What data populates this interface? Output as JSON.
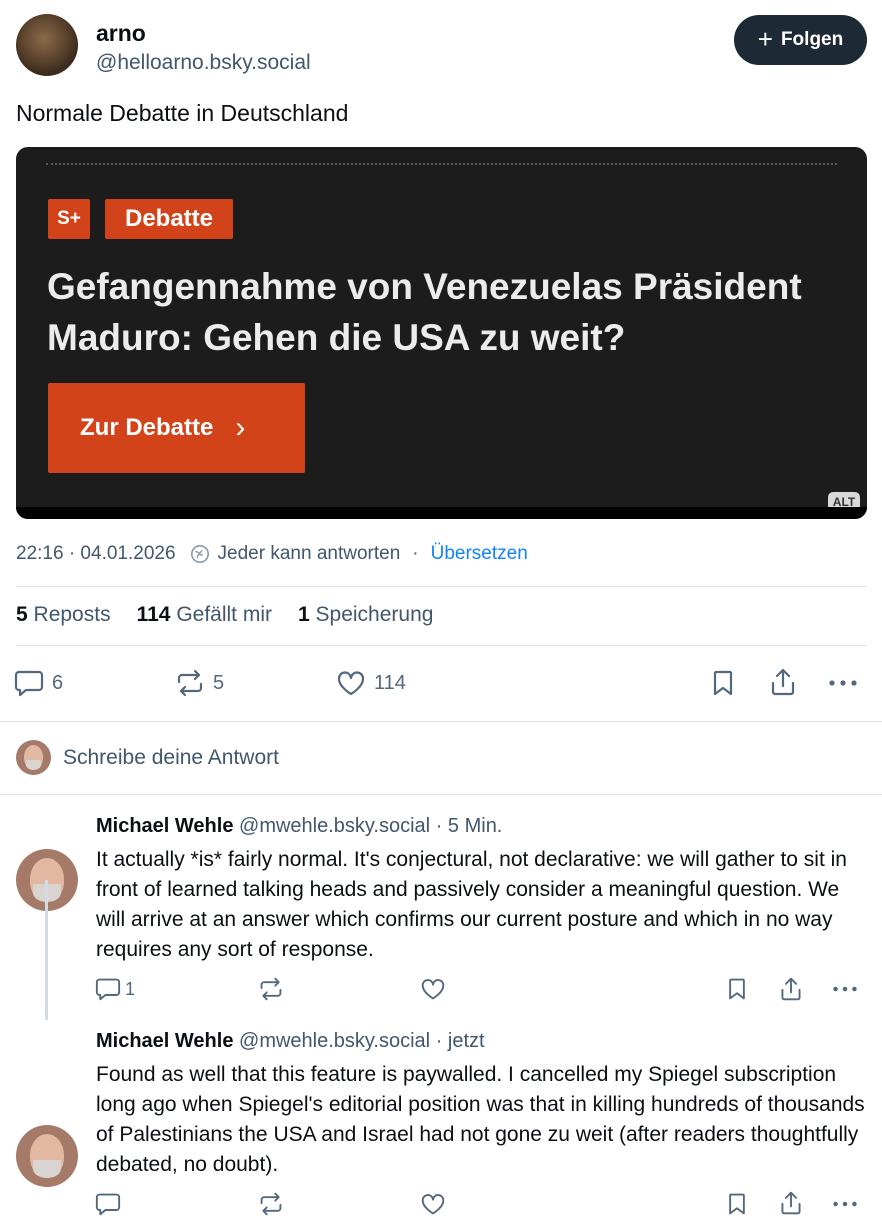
{
  "post": {
    "author_name": "arno",
    "author_handle": "@helloarno.bsky.social",
    "follow_label": "Folgen",
    "text": "Normale Debatte in Deutschland",
    "embed": {
      "badge_s": "S+",
      "badge_category": "Debatte",
      "headline": "Gefangennahme von Venezuelas Präsident Maduro: Gehen die USA zu weit?",
      "cta_label": "Zur Debatte",
      "cta_arrow": "›",
      "alt_label": "ALT"
    },
    "timestamp": "22:16 · 04.01.2026",
    "reply_setting": "Jeder kann antworten",
    "separator": "·",
    "translate_label": "Übersetzen",
    "stats": {
      "reposts_count": "5",
      "reposts_label": "Reposts",
      "likes_count": "114",
      "likes_label": "Gefällt mir",
      "saves_count": "1",
      "saves_label": "Speicherung"
    },
    "actions": {
      "replies": "6",
      "reposts": "5",
      "likes": "114"
    }
  },
  "composer": {
    "placeholder": "Schreibe deine Antwort"
  },
  "comments": [
    {
      "name": "Michael Wehle",
      "handle": "@mwehle.bsky.social",
      "time": "· 5 Min.",
      "text": "It actually *is* fairly normal. It's conjectural, not declarative: we will gather to sit in front of learned talking heads and passively consider a meaningful question. We will arrive at an answer which confirms our current posture and which in no way requires any sort of response.",
      "reply_count": "1"
    },
    {
      "name": "Michael Wehle",
      "handle": "@mwehle.bsky.social",
      "time": "· jetzt",
      "text": "Found as well that this feature is paywalled. I cancelled my Spiegel subscription long ago when Spiegel's editorial position was that in killing hundreds of thousands of Palestinians the USA and Israel had not gone zu weit (after readers thoughtfully debated, no doubt).",
      "reply_count": ""
    }
  ],
  "colors": {
    "accent_link": "#1083fe",
    "follow_bg": "#1e2936",
    "spiegel_orange": "#d2431a",
    "muted_text": "#42576c"
  },
  "icons": {
    "reply": "speech-bubble-icon",
    "repost": "repost-arrows-icon",
    "like": "heart-icon",
    "bookmark": "bookmark-icon",
    "share": "share-upload-icon",
    "more": "ellipsis-icon",
    "reply_setting": "globe-icon"
  }
}
